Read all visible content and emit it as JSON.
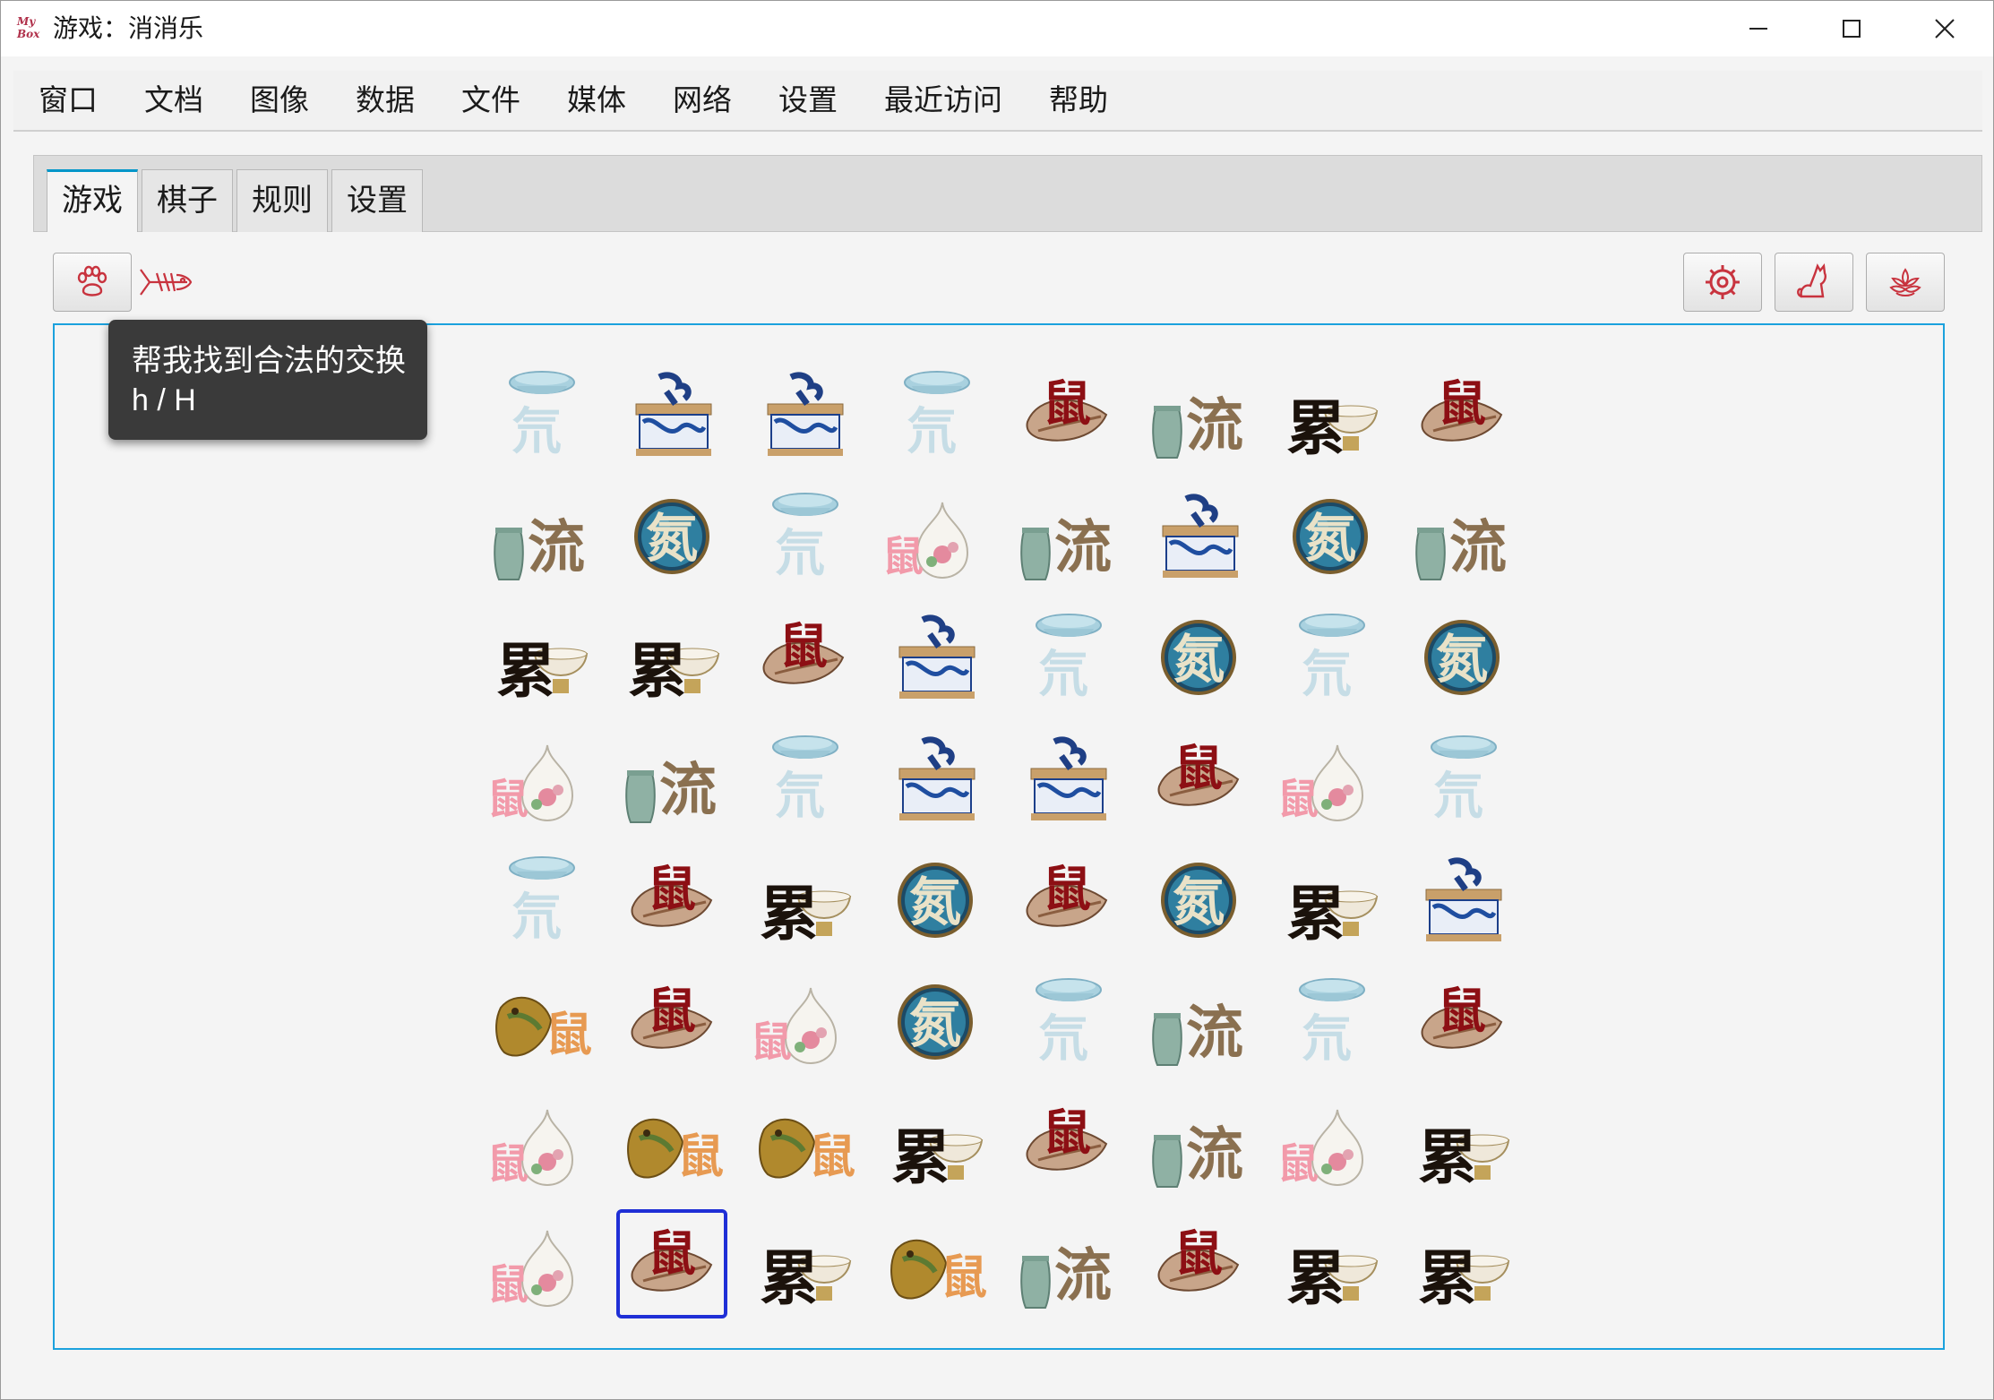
{
  "window": {
    "title": "游戏：消消乐",
    "logo_text": "My Box"
  },
  "menu": [
    "窗口",
    "文档",
    "图像",
    "数据",
    "文件",
    "媒体",
    "网络",
    "设置",
    "最近访问",
    "帮助"
  ],
  "tabs": [
    {
      "label": "游戏",
      "active": true
    },
    {
      "label": "棋子",
      "active": false
    },
    {
      "label": "规则",
      "active": false
    },
    {
      "label": "设置",
      "active": false
    }
  ],
  "toolbar": {
    "left": [
      {
        "icon": "paw-icon"
      },
      {
        "icon": "fish-bone-icon"
      }
    ],
    "right": [
      {
        "icon": "gear-icon"
      },
      {
        "icon": "cat-icon"
      },
      {
        "icon": "flower-icon"
      }
    ]
  },
  "tooltip": {
    "line1": "帮我找到合法的交换",
    "line2": "h / H"
  },
  "board": {
    "rows": 8,
    "cols": 8,
    "selected": {
      "row": 7,
      "col": 1
    },
    "piece_legend": {
      "A": "pale-blue-plate",
      "B": "blue-white-box",
      "C": "conch-shell",
      "D": "celadon-jar",
      "E": "ink-bowl",
      "F": "dark-blue-dish",
      "G": "famille-rose-vase",
      "H": "bronze-fish-vessel"
    },
    "grid": [
      [
        "A",
        "B",
        "B",
        "A",
        "C",
        "D",
        "E",
        "C"
      ],
      [
        "D",
        "F",
        "A",
        "G",
        "D",
        "B",
        "F",
        "D"
      ],
      [
        "E",
        "E",
        "C",
        "B",
        "A",
        "F",
        "A",
        "F"
      ],
      [
        "G",
        "D",
        "A",
        "B",
        "B",
        "C",
        "G",
        "A"
      ],
      [
        "A",
        "C",
        "E",
        "F",
        "C",
        "F",
        "E",
        "B"
      ],
      [
        "H",
        "C",
        "G",
        "F",
        "A",
        "D",
        "A",
        "C"
      ],
      [
        "G",
        "H",
        "H",
        "E",
        "C",
        "D",
        "G",
        "E"
      ],
      [
        "G",
        "C",
        "E",
        "H",
        "D",
        "C",
        "E",
        "E"
      ]
    ]
  },
  "colors": {
    "accent": "#1ba1dd",
    "selection": "#1f2fd6",
    "icon": "#c8333e"
  }
}
